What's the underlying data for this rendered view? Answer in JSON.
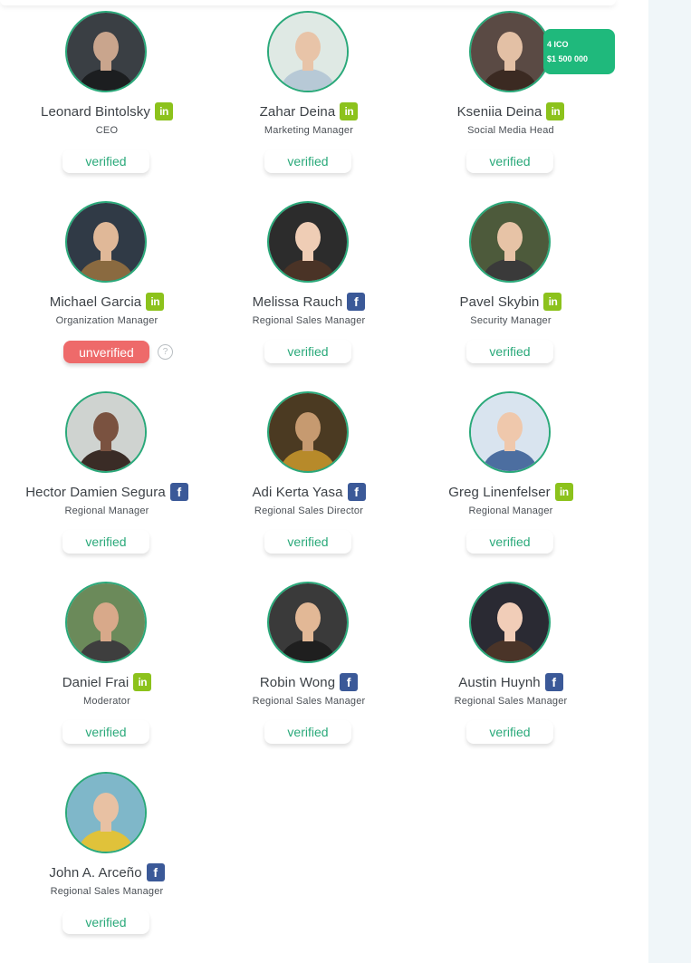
{
  "members": [
    {
      "name": "Leonard Bintolsky",
      "role": "CEO",
      "social": "linkedin",
      "social_glyph": "in",
      "status": "verified"
    },
    {
      "name": "Zahar Deina",
      "role": "Marketing Manager",
      "social": "linkedin",
      "social_glyph": "in",
      "status": "verified"
    },
    {
      "name": "Kseniia Deina",
      "role": "Social Media Head",
      "social": "linkedin",
      "social_glyph": "in",
      "status": "verified"
    },
    {
      "name": "Michael Garcia",
      "role": "Organization Manager",
      "social": "linkedin",
      "social_glyph": "in",
      "status": "unverified"
    },
    {
      "name": "Melissa Rauch",
      "role": "Regional Sales Manager",
      "social": "facebook",
      "social_glyph": "f",
      "status": "verified"
    },
    {
      "name": "Pavel Skybin",
      "role": "Security Manager",
      "social": "linkedin",
      "social_glyph": "in",
      "status": "verified"
    },
    {
      "name": "Hector Damien Segura",
      "role": "Regional Manager",
      "social": "facebook",
      "social_glyph": "f",
      "status": "verified"
    },
    {
      "name": "Adi Kerta Yasa",
      "role": "Regional Sales Director",
      "social": "facebook",
      "social_glyph": "f",
      "status": "verified"
    },
    {
      "name": "Greg Linenfelser",
      "role": "Regional Manager",
      "social": "linkedin",
      "social_glyph": "in",
      "status": "verified"
    },
    {
      "name": "Daniel Frai",
      "role": "Moderator",
      "social": "linkedin",
      "social_glyph": "in",
      "status": "verified"
    },
    {
      "name": "Robin Wong",
      "role": "Regional Sales Manager",
      "social": "facebook",
      "social_glyph": "f",
      "status": "verified"
    },
    {
      "name": "Austin Huynh",
      "role": "Regional Sales Manager",
      "social": "facebook",
      "social_glyph": "f",
      "status": "verified"
    },
    {
      "name": "John A. Arceño",
      "role": "Regional Sales Manager",
      "social": "facebook",
      "social_glyph": "f",
      "status": "verified"
    }
  ],
  "ico_badge": {
    "line1": "4 ICO",
    "line2": "$1 500 000"
  },
  "help_glyph": "?",
  "colors": {
    "accent": "#2aa97a",
    "linkedin": "#8cc21c",
    "facebook": "#3b5998",
    "unverified": "#ee6a6a",
    "badge": "#1fb97c"
  }
}
